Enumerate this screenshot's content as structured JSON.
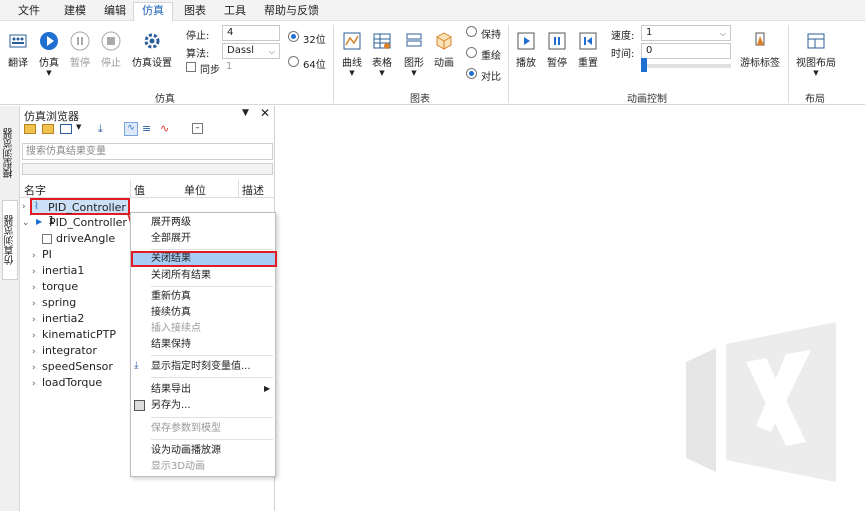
{
  "menubar": {
    "items": [
      "文件",
      "建模",
      "编辑",
      "仿真",
      "图表",
      "工具",
      "帮助与反馈"
    ],
    "active": "仿真"
  },
  "ribbon": {
    "translate": "翻译",
    "simulate": "仿真",
    "pause": "暂停",
    "stop": "停止",
    "sim_settings": "仿真设置",
    "stop_time_label": "停止:",
    "stop_time_value": "4",
    "algo_label": "算法:",
    "algo_value": "Dassl",
    "sync_label": "同步",
    "sync_value": "1",
    "bit32": "32位",
    "bit64": "64位",
    "group_sim": "仿真",
    "curve": "曲线",
    "table": "表格",
    "shape": "图形",
    "animation": "动画",
    "keep": "保持",
    "redraw": "重绘",
    "compare": "对比",
    "group_chart": "图表",
    "play": "播放",
    "pause2": "暂停",
    "reset": "重置",
    "speed_label": "速度:",
    "speed_value": "1",
    "time_label": "时间:",
    "time_value": "0",
    "cursor_label": "游标标签",
    "group_anim": "动画控制",
    "view_layout": "视图布局",
    "group_layout": "布局"
  },
  "sidetabs": {
    "model": "模型浏览器",
    "sim": "仿真浏览器"
  },
  "panel": {
    "title": "仿真浏览器",
    "search_placeholder": "搜索仿真结果变量",
    "cols": {
      "name": "名字",
      "value": "值",
      "unit": "单位",
      "desc": "描述"
    },
    "items": [
      "PID_Controller 1",
      "PID_Controller 2",
      "driveAngle",
      "PI",
      "inertia1",
      "torque",
      "spring",
      "inertia2",
      "kinematicPTP",
      "integrator",
      "speedSensor",
      "loadTorque"
    ]
  },
  "context_menu": {
    "expand_two": "展开两级",
    "expand_all": "全部展开",
    "close_result": "关闭结果",
    "close_all": "关闭所有结果",
    "resim": "重新仿真",
    "continue": "接续仿真",
    "insert_point": "插入接续点",
    "keep_result": "结果保持",
    "show_var": "显示指定时刻变量值...",
    "export": "结果导出",
    "save_as": "另存为...",
    "save_params": "保存参数到模型",
    "set_anim": "设为动画播放源",
    "show3d": "显示3D动画"
  },
  "colors": {
    "accent": "#1f6fd1",
    "highlight": "#a8cdf5",
    "annotation": "#e01b24"
  }
}
